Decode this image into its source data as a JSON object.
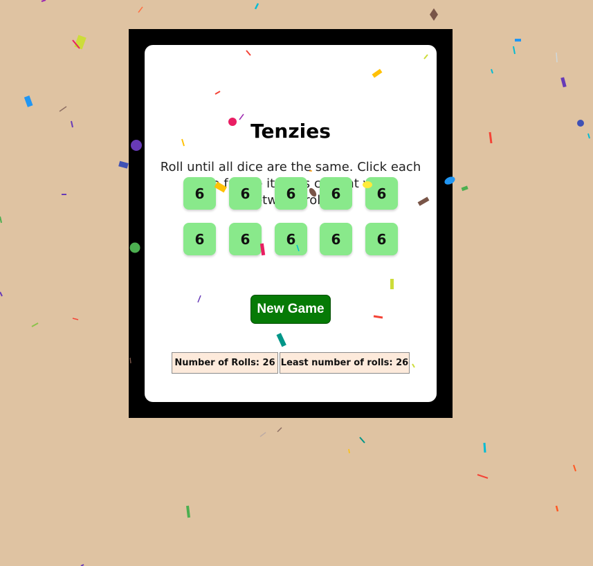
{
  "game": {
    "title": "Tenzies",
    "instructions": "Roll until all dice are the same. Click each die to freeze it at its current value between rolls.",
    "dice": [
      6,
      6,
      6,
      6,
      6,
      6,
      6,
      6,
      6,
      6
    ],
    "new_game_label": "New Game",
    "rolls_label": "Number of Rolls: 26",
    "least_rolls_label": "Least number of rolls: 26"
  },
  "colors": {
    "background": "#dfc3a2",
    "frame": "#000000",
    "card": "#ffffff",
    "die_held": "#89e98b",
    "button": "#067a06",
    "stat_box": "#fdeadb"
  }
}
